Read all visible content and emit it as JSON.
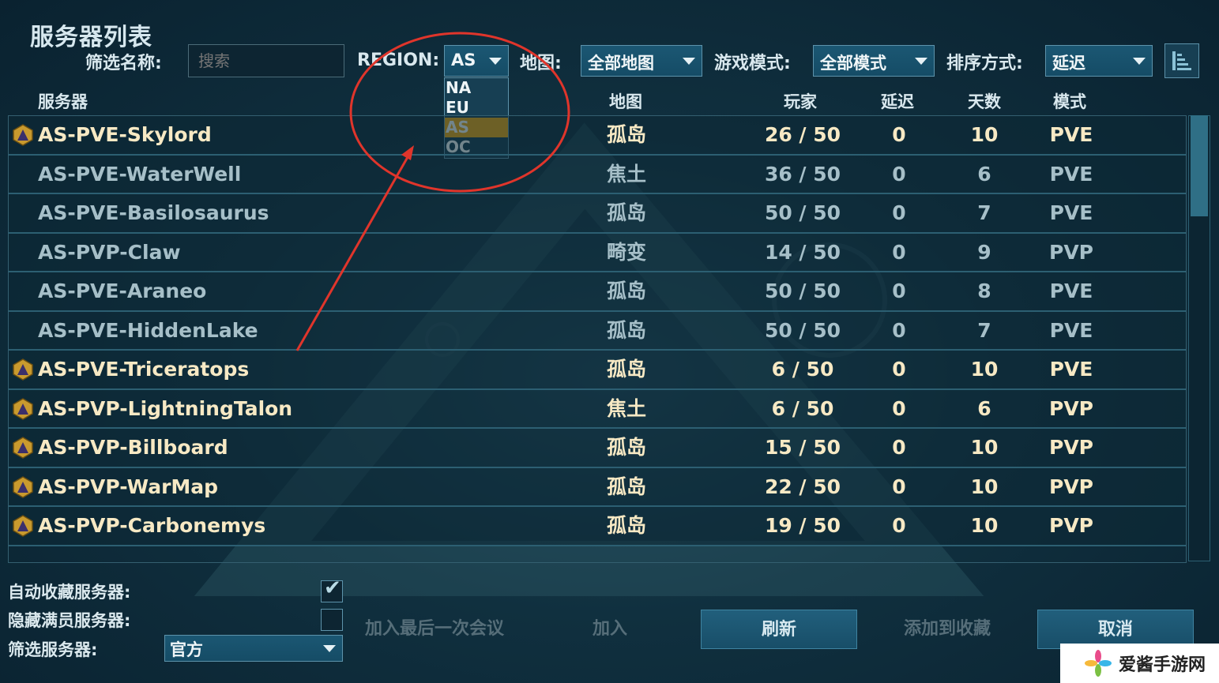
{
  "title": "服务器列表",
  "filters": {
    "name_label": "筛选名称:",
    "search_placeholder": "搜索",
    "region_label": "REGION:",
    "region_value": "AS",
    "region_options": [
      "NA",
      "EU",
      "AS",
      "OC"
    ],
    "region_selected": "AS",
    "map_label": "地图:",
    "map_value": "全部地图",
    "mode_label": "游戏模式:",
    "mode_value": "全部模式",
    "sort_label": "排序方式:",
    "sort_value": "延迟"
  },
  "columns": {
    "server": "服务器",
    "map": "地图",
    "players": "玩家",
    "ping": "延迟",
    "days": "天数",
    "mode": "模式"
  },
  "servers": [
    {
      "name": "AS-PVE-Skylord",
      "map": "孤岛",
      "players": "26 / 50",
      "ping": "0",
      "days": "10",
      "mode": "PVE",
      "official": true
    },
    {
      "name": "AS-PVE-WaterWell",
      "map": "焦土",
      "players": "36 / 50",
      "ping": "0",
      "days": "6",
      "mode": "PVE",
      "official": false
    },
    {
      "name": "AS-PVE-Basilosaurus",
      "map": "孤岛",
      "players": "50 / 50",
      "ping": "0",
      "days": "7",
      "mode": "PVE",
      "official": false
    },
    {
      "name": "AS-PVP-Claw",
      "map": "畸变",
      "players": "14 / 50",
      "ping": "0",
      "days": "9",
      "mode": "PVP",
      "official": false
    },
    {
      "name": "AS-PVE-Araneo",
      "map": "孤岛",
      "players": "50 / 50",
      "ping": "0",
      "days": "8",
      "mode": "PVE",
      "official": false
    },
    {
      "name": "AS-PVE-HiddenLake",
      "map": "孤岛",
      "players": "50 / 50",
      "ping": "0",
      "days": "7",
      "mode": "PVE",
      "official": false
    },
    {
      "name": "AS-PVE-Triceratops",
      "map": "孤岛",
      "players": "6 / 50",
      "ping": "0",
      "days": "10",
      "mode": "PVE",
      "official": true
    },
    {
      "name": "AS-PVP-LightningTalon",
      "map": "焦土",
      "players": "6 / 50",
      "ping": "0",
      "days": "6",
      "mode": "PVP",
      "official": true
    },
    {
      "name": "AS-PVP-Billboard",
      "map": "孤岛",
      "players": "15 / 50",
      "ping": "0",
      "days": "10",
      "mode": "PVP",
      "official": true
    },
    {
      "name": "AS-PVP-WarMap",
      "map": "孤岛",
      "players": "22 / 50",
      "ping": "0",
      "days": "10",
      "mode": "PVP",
      "official": true
    },
    {
      "name": "AS-PVP-Carbonemys",
      "map": "孤岛",
      "players": "19 / 50",
      "ping": "0",
      "days": "10",
      "mode": "PVP",
      "official": true
    }
  ],
  "bottom": {
    "auto_fav_label": "自动收藏服务器:",
    "auto_fav_checked": true,
    "hide_full_label": "隐藏满员服务器:",
    "hide_full_checked": false,
    "filter_server_label": "筛选服务器:",
    "filter_server_value": "官方",
    "join_last_label": "加入最后一次会议",
    "join_label": "加入",
    "refresh_label": "刷新",
    "add_fav_label": "添加到收藏",
    "cancel_label": "取消"
  },
  "watermark": {
    "text": "爱酱手游网"
  },
  "colors": {
    "official_text": "#f7e9c4",
    "normal_text": "#a6bfc8",
    "selected_option": "#e2a514",
    "annotation": "#e0352b"
  }
}
